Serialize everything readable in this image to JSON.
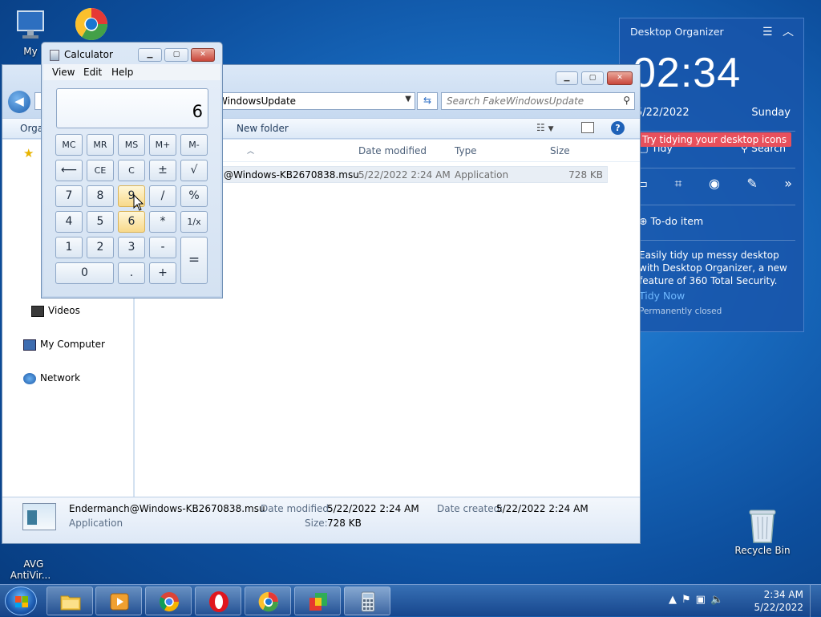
{
  "desktop": {
    "icons": [
      {
        "label": "My"
      },
      {
        "label": "AVG\nAntiVir..."
      },
      {
        "label": "Recycle Bin"
      }
    ]
  },
  "organizer": {
    "title": "Desktop Organizer",
    "time": "02:34",
    "date": "5/22/2022",
    "day": "Sunday",
    "tip": "Try tidying your desktop icons",
    "tidy": "Tidy",
    "search": "Search",
    "todo": "To-do item",
    "desc": "Easily tidy up messy desktop with Desktop Organizer, a new feature of 360 Total Security.",
    "tidy_now": "Tidy Now",
    "permanent": "Permanently closed"
  },
  "explorer": {
    "address": "WindowsUpdate",
    "search_placeholder": "Search FakeWindowsUpdate",
    "toolbar": {
      "organize": "Orga",
      "new_folder": "New folder"
    },
    "nav": [
      "Videos",
      "My Computer",
      "Network"
    ],
    "columns": [
      "Date modified",
      "Type",
      "Size"
    ],
    "files": [
      {
        "name": "@Windows-KB2670838.msu",
        "date": "5/22/2022 2:24 AM",
        "type": "Application",
        "size": "728 KB"
      }
    ],
    "details": {
      "filename": "Endermanch@Windows-KB2670838.msu",
      "type": "Application",
      "date_modified_label": "Date modified:",
      "date_modified": "5/22/2022 2:24 AM",
      "date_created_label": "Date created:",
      "date_created": "5/22/2022 2:24 AM",
      "size_label": "Size:",
      "size": "728 KB"
    }
  },
  "calculator": {
    "title": "Calculator",
    "menu": [
      "View",
      "Edit",
      "Help"
    ],
    "display": "6",
    "keys": {
      "mc": "MC",
      "mr": "MR",
      "ms": "MS",
      "mplus": "M+",
      "mminus": "M-",
      "back": "⟵",
      "ce": "CE",
      "c": "C",
      "pm": "±",
      "sqrt": "√",
      "k7": "7",
      "k8": "8",
      "k9": "9",
      "div": "/",
      "pct": "%",
      "k4": "4",
      "k5": "5",
      "k6": "6",
      "mul": "*",
      "inv": "1/x",
      "k1": "1",
      "k2": "2",
      "k3": "3",
      "sub": "-",
      "eq": "=",
      "k0": "0",
      "dot": ".",
      "add": "+"
    }
  },
  "taskbar": {
    "time": "2:34 AM",
    "date": "5/22/2022"
  }
}
